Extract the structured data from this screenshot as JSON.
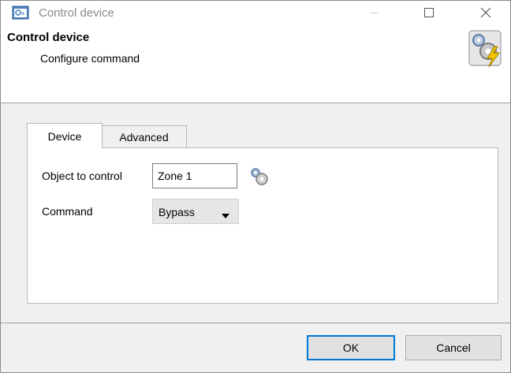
{
  "window": {
    "title": "Control device"
  },
  "header": {
    "title": "Control device",
    "subtitle": "Configure command",
    "icon": "gear-lightning-icon"
  },
  "tabs": [
    {
      "label": "Device",
      "selected": true
    },
    {
      "label": "Advanced",
      "selected": false
    }
  ],
  "form": {
    "object_label": "Object to control",
    "object_value": "Zone 1",
    "object_picker_icon": "gear-icon",
    "command_label": "Command",
    "command_value": "Bypass"
  },
  "buttons": {
    "ok": "OK",
    "cancel": "Cancel"
  },
  "colors": {
    "accent": "#0078d7",
    "dialog_bg": "#f0f0f0",
    "panel_bg": "#ffffff"
  }
}
